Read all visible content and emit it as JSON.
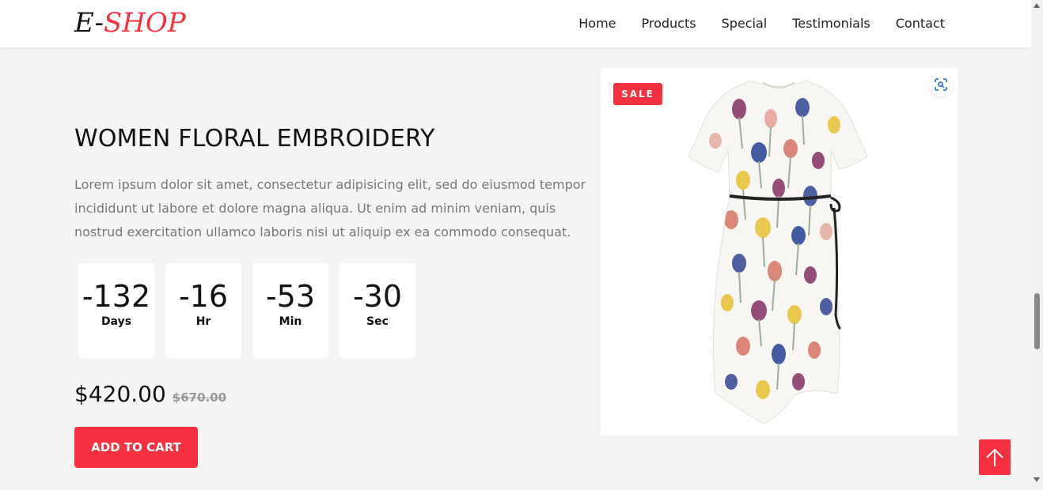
{
  "brand": {
    "prefix": "E-",
    "name": "SHOP"
  },
  "nav": {
    "items": [
      {
        "label": "Home"
      },
      {
        "label": "Products"
      },
      {
        "label": "Special"
      },
      {
        "label": "Testimonials"
      },
      {
        "label": "Contact"
      }
    ]
  },
  "product": {
    "title": "WOMEN FLORAL EMBROIDERY",
    "description": "Lorem ipsum dolor sit amet, consectetur adipisicing elit, sed do eiusmod tempor incididunt ut labore et dolore magna aliqua. Ut enim ad minim veniam, quis nostrud exercitation ullamco laboris nisi ut aliquip ex ea commodo consequat.",
    "price": "$420.00",
    "old_price": "$670.00",
    "add_to_cart_label": "ADD TO CART",
    "sale_badge": "SALE"
  },
  "countdown": {
    "days": {
      "value": "-132",
      "label": "Days"
    },
    "hours": {
      "value": "-16",
      "label": "Hr"
    },
    "minutes": {
      "value": "-53",
      "label": "Min"
    },
    "seconds": {
      "value": "-30",
      "label": "Sec"
    }
  },
  "icons": {
    "zoom": "zoom-scan-icon",
    "scroll_top": "arrow-up-icon",
    "product_image": "floral-dress-image"
  },
  "colors": {
    "accent": "#f7303f",
    "page_bg": "#f4f4f4",
    "text": "#111111",
    "muted": "#777777"
  }
}
